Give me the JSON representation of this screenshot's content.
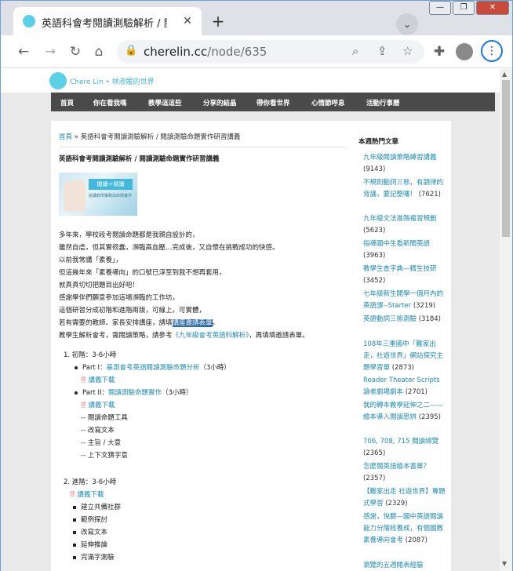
{
  "browser": {
    "tab_title": "英語科會考閱讀測驗解析 / 閱讀測驗",
    "url_host": "cherelin.cc",
    "url_path": "/node/635",
    "window_buttons": [
      "—",
      "❐",
      "✕"
    ]
  },
  "site": {
    "title": "Chere Lin • 林淑媛的世界",
    "nav": [
      "首頁",
      "你在看我嗎",
      "教學這這些",
      "分享的結晶",
      "帶你看世界",
      "心情節呼息",
      "活動行事曆"
    ]
  },
  "article": {
    "breadcrumb_home": "首頁",
    "breadcrumb_rest": " » 英語科會考閱讀測驗解析 / 閱讀測驗命題實作研習講義",
    "title": "英語科會考閱讀測驗解析 / 閱讀測驗命題實作研習講義",
    "image": {
      "label": "閱讀＋精讀",
      "sub": "閱讀教學策略與命題實作"
    },
    "paragraphs": [
      "多年來，學校段考閱讀命題都是我親自設計的，",
      "雖然自虐，但其實很蠢，瀕臨高血壓…完成後，又自懷在挑戰成功的快感。",
      "以前我常講「素養」，",
      "但這幾年來「素養導向」的口號已淳至到我不想再套用，",
      "就真真切切把題目出好吧！",
      "感謝學伴們願意參加這場瀕臨的工作坊，",
      "這個研習分成初階和進階兩版，可線上，可實體，"
    ],
    "para8_before": "若有需要的教師、家長安排講座，請填",
    "para8_link": "講座邀請表單",
    "para8_after": "。",
    "para9_before": "教學生解析會考，需閱讀策略，請參考",
    "para9_link": "《九年級會考英語科解析》",
    "para9_after": "，再填填邀請表單。",
    "list": {
      "level1": "1. 初階：3-6小時",
      "part1_label": "Part I：",
      "part1_link": "基測會考英語閱讀測驗命題分析",
      "part1_tail": "（3小時）",
      "part1_dl": "講義下載",
      "part2_label": "Part II：",
      "part2_link": "閱讀測驗命題實作",
      "part2_tail": "（3小時）",
      "part2_dl": "講義下載",
      "part2_items": [
        "-- 閱讀命題工具",
        "-- 改寫文本",
        "-- 主旨 / 大意",
        "-- 上下文猜字意"
      ],
      "level2": "2. 進階：3-6小時",
      "level2_dl": "講義下載",
      "level2_items": [
        "建立共備社群",
        "範例探討",
        "改寫文本",
        "延伸推論",
        "完滿字測驗"
      ]
    }
  },
  "sidebar": {
    "title": "本週熱門文章",
    "items": [
      {
        "text": "九年級閱讀策略練習講義",
        "count": "(9143)"
      },
      {
        "text": "不規則動詞三態，有韻律的背誦，要記整嘍！",
        "count": "(7621)"
      },
      {
        "text": "九年級文法進階複習規劃",
        "count": "(5623)"
      },
      {
        "text": "指導國中生看新聞英語",
        "count": "(3963)"
      },
      {
        "text": "教學生查字典—精生技研",
        "count": "(3452)"
      },
      {
        "text": "七年級新生開學一個月內的英語課--Starter",
        "count": "(3219)"
      },
      {
        "text": "英語動詞三態測驗",
        "count": "(3184)"
      },
      {
        "text": "108年三重國中「難家出走，社遊世界」網站探究主題學習單",
        "count": "(2873)"
      },
      {
        "text": "Reader Theater Scripts 讀者劇場劇本",
        "count": "(2701)"
      },
      {
        "text": "我的轉本教學延伸之二——繪本導入閱讀思辨",
        "count": "(2395)"
      },
      {
        "text": "706, 708, 715 閱讀總覽",
        "count": "(2365)"
      },
      {
        "text": "怎麼閱英語繪本書單？",
        "count": "(2357)"
      },
      {
        "text": "【難家出走 社遊世界】專題式學習",
        "count": "(2329)"
      },
      {
        "text": "感謝，悅聽—國中英語閱讀能力分階段養成，有個國教素養導向會考",
        "count": "(2087)"
      },
      {
        "text": "瀏覽的五週閱表經驗",
        "count": ""
      }
    ]
  },
  "colors": {
    "accent": "#45b7d6",
    "nav_bg": "#4a4a4a",
    "link": "#1d8bb0"
  }
}
